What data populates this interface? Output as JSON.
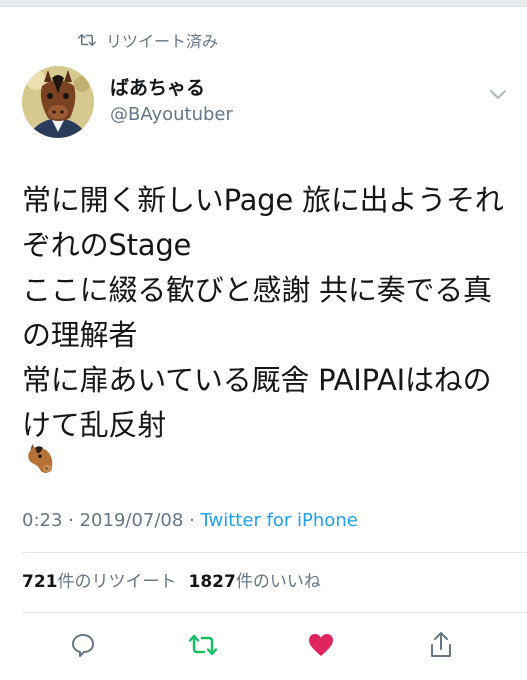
{
  "retweet_context": {
    "label": "リツイート済み",
    "icon": "retweet-icon"
  },
  "author": {
    "display_name": "ばあちゃる",
    "handle": "@BAyoutuber",
    "avatar_icon": "horse-mask-avatar"
  },
  "tweet": {
    "text": "常に開く新しいPage 旅に出ようそれぞれのStage\nここに綴る歓びと感謝 共に奏でる真の理解者\n常に扉あいている厩舎 PAIPAIはねのけて乱反射",
    "emoji": "horse-face-emoji"
  },
  "meta": {
    "time": "0:23",
    "separator": " · ",
    "date": "2019/07/08",
    "source": "Twitter for iPhone"
  },
  "stats": {
    "retweet_count": "721",
    "retweet_label": "件のリツイート",
    "like_count": "1827",
    "like_label": "件のいいね"
  },
  "colors": {
    "accent": "#1da1f2",
    "retweet_active": "#17bf63",
    "like_active": "#e0245e",
    "muted": "#657786"
  }
}
